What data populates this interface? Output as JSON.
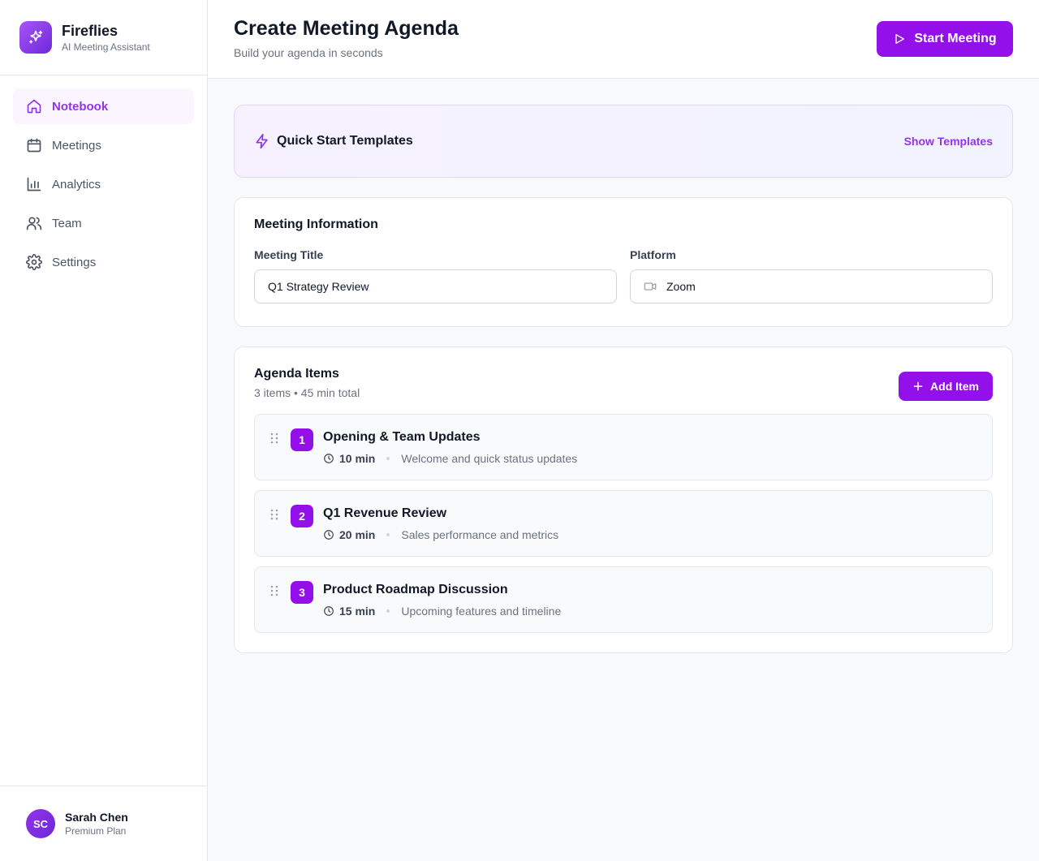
{
  "brand": {
    "name": "Fireflies",
    "subtitle": "AI Meeting Assistant",
    "icon": "sparkles-icon"
  },
  "sidebar": {
    "items": [
      {
        "label": "Notebook",
        "icon": "home-icon",
        "active": true
      },
      {
        "label": "Meetings",
        "icon": "calendar-icon",
        "active": false
      },
      {
        "label": "Analytics",
        "icon": "bar-chart-icon",
        "active": false
      },
      {
        "label": "Team",
        "icon": "users-icon",
        "active": false
      },
      {
        "label": "Settings",
        "icon": "gear-icon",
        "active": false
      }
    ]
  },
  "user": {
    "initials": "SC",
    "name": "Sarah Chen",
    "plan": "Premium Plan"
  },
  "header": {
    "title": "Create Meeting Agenda",
    "subtitle": "Build your agenda in seconds",
    "start_label": "Start Meeting"
  },
  "templates": {
    "title": "Quick Start Templates",
    "action": "Show Templates"
  },
  "meeting_info": {
    "title": "Meeting Information",
    "title_label": "Meeting Title",
    "title_value": "Q1 Strategy Review",
    "platform_label": "Platform",
    "platform_value": "Zoom"
  },
  "agenda": {
    "title": "Agenda Items",
    "summary": "3 items • 45 min total",
    "add_label": "Add Item",
    "items": [
      {
        "number": "1",
        "title": "Opening & Team Updates",
        "duration": "10 min",
        "description": "Welcome and quick status updates"
      },
      {
        "number": "2",
        "title": "Q1 Revenue Review",
        "duration": "20 min",
        "description": "Sales performance and metrics"
      },
      {
        "number": "3",
        "title": "Product Roadmap Discussion",
        "duration": "15 min",
        "description": "Upcoming features and timeline"
      }
    ]
  },
  "colors": {
    "accent": "#9310eb",
    "accent_text": "#9333ea",
    "active_bg": "#faf5ff"
  }
}
